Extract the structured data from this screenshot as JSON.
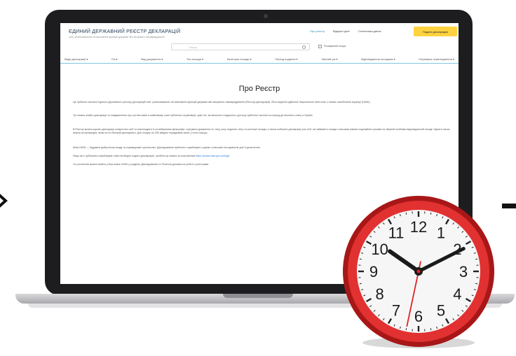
{
  "site": {
    "title": "ЄДИНИЙ ДЕРЖАВНИЙ РЕЄСТР ДЕКЛАРАЦІЙ",
    "subtitle": "осіб, уповноважених на виконання функцій держави або місцевого самоврядування"
  },
  "top_links": [
    "Про реєстр",
    "Відкриті дані",
    "Статистика даних"
  ],
  "declare_button": "Подати декларацію",
  "search": {
    "placeholder": "Пошук",
    "advanced_label": "Розширений пошук"
  },
  "nav": [
    "Види декларації ▾",
    "Рік ▾",
    "Вид документа ▾",
    "Тип посади ▾",
    "Категорія посади ▾",
    "Період подання ▾",
    "Звітний рік ▾",
    "Відповідальна посадова ▾",
    "Перевірка оприлюднення ▾"
  ],
  "page": {
    "heading": "Про Реєстр",
    "paragraphs": [
      "Це публічна частина Єдиного державного реєстру декларацій осіб, уповноважених на виконання функцій держави або місцевого самоврядування (Реєстру декларацій). Його ведення здійснює Національне агентство з питань запобігання корупції (НАЗК).",
      "Тут можна знайти декларації та повідомлення про суттєві зміни в майновому стані публічних службовців, крім тих, які включені з відкритого доступу публічної частини на період дії воєнного стану в Україні.",
      "В Реєстрі можна шукати декларації конкретних осіб та переглядати їх за вибраними фільтрами: сортувати документи по типу, року подання, типу та категорії посади, а також побачити декларації усіх осіб, які займають посади з високим рівнем корупційних ризиків на обраній особливо відповідальній посаді. Шукати також можна за прізвищем, ім'ям чи по батькові декларанта. Для пошуку по ПІБ введіть порядковий запит у поле пошуку.",
      "Місія НАЗК — будувати доброчесну владу та справедливе суспільство. Декларування публічних службовців є одним з ключових інструментів для її досягнення.",
      "Якщо ви є публічним службовцем і вам необхідно подати декларацію, зробити це можна за посиланням",
      "Усі уточнення можна знайти у Базі знань НАЗК у розділах Декларування та Технічна допомога в роботі з реєстрами."
    ],
    "link": "https://portal.nazk.gov.ua/login"
  },
  "clock_face": {
    "numerals": [
      "12",
      "1",
      "2",
      "3",
      "4",
      "5",
      "6",
      "7",
      "8",
      "9",
      "10",
      "11"
    ],
    "time": "10:10:32"
  },
  "colors": {
    "accent_yellow": "#ffd23f",
    "nav_underline": "#7fc6e3",
    "clock_red": "#d42a2a",
    "laptop_bezel": "#1d1d1f"
  }
}
